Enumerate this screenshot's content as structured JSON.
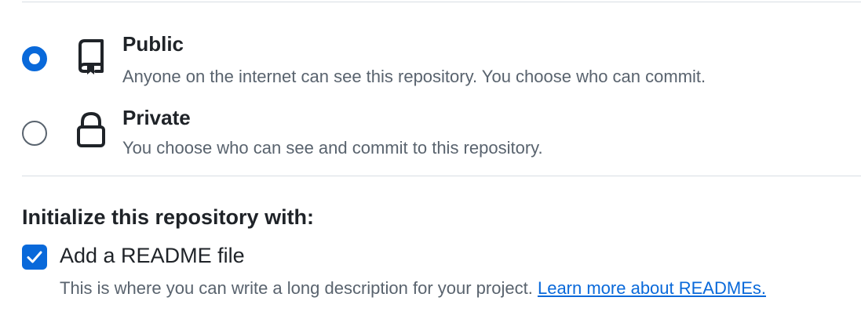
{
  "visibility": {
    "selected": "public",
    "options": [
      {
        "id": "public",
        "title": "Public",
        "description": "Anyone on the internet can see this repository. You choose who can commit.",
        "icon": "repo-icon",
        "checked": true
      },
      {
        "id": "private",
        "title": "Private",
        "description": "You choose who can see and commit to this repository.",
        "icon": "lock-icon",
        "checked": false
      }
    ]
  },
  "initialize": {
    "heading": "Initialize this repository with:",
    "readme": {
      "label": "Add a README file",
      "checked": true,
      "description": "This is where you can write a long description for your project.",
      "link_text": "Learn more about READMEs."
    }
  },
  "colors": {
    "accent": "#0969da",
    "text_primary": "#1f2328",
    "text_muted": "#59636e",
    "divider": "#d8dee4"
  }
}
